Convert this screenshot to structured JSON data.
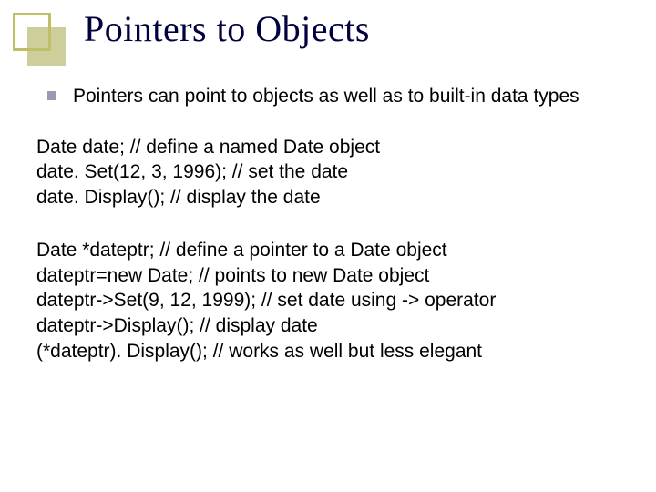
{
  "slide": {
    "title": "Pointers to Objects",
    "bullet1": "Pointers can point to objects as well as to built-in data types",
    "code1_l1": "Date date;   // define a named Date object",
    "code1_l2": "date. Set(12, 3, 1996); // set the date",
    "code1_l3": "date. Display();  // display the date",
    "code2_l1": "Date *dateptr; // define a pointer to a Date object",
    "code2_l2": "dateptr=new Date; // points to new Date object",
    "code2_l3": "dateptr->Set(9, 12, 1999);  // set date using -> operator",
    "code2_l4": "dateptr->Display();  // display date",
    "code2_l5": "(*dateptr). Display();  // works as well but less elegant"
  }
}
